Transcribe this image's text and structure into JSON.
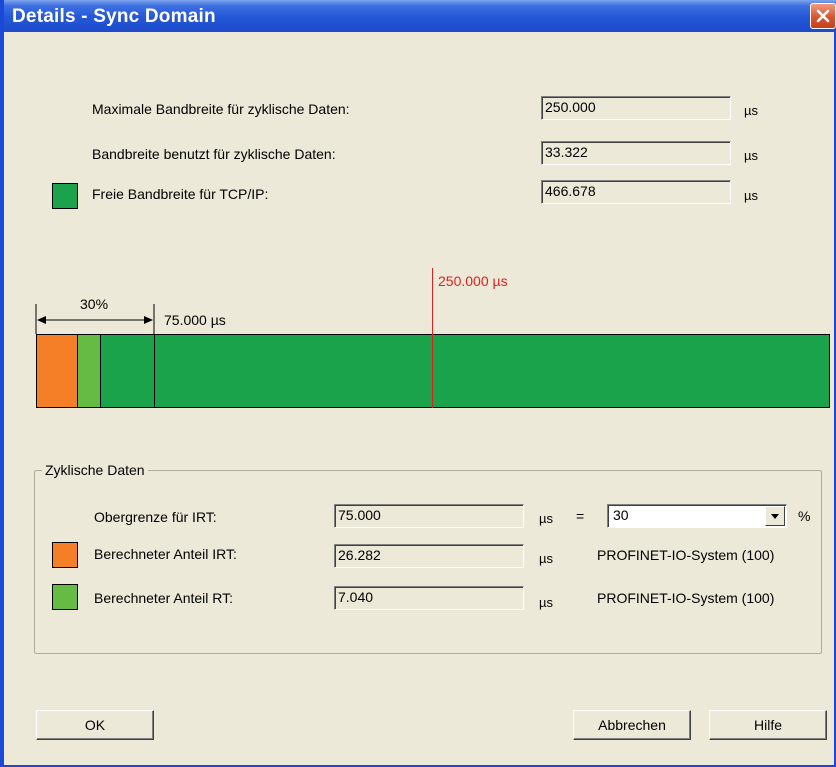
{
  "window": {
    "title": "Details - Sync Domain"
  },
  "bandwidth": {
    "max_label": "Maximale Bandbreite für zyklische Daten:",
    "max_value": "250.000",
    "used_label": "Bandbreite benutzt für zyklische Daten:",
    "used_value": "33.322",
    "free_label": "Freie Bandbreite für TCP/IP:",
    "free_value": "466.678",
    "unit": "µs",
    "free_color": "#1aa34a"
  },
  "chart": {
    "marker_label": "250.000 µs",
    "percent_label": "30%",
    "limit_label": "75.000 µs",
    "marker_color": "#e02020"
  },
  "cyclic": {
    "group_title": "Zyklische Daten",
    "irt_limit_label": "Obergrenze für IRT:",
    "irt_limit_value": "75.000",
    "unit": "µs",
    "equals": "=",
    "percent_value": "30",
    "percent_sign": "%",
    "irt_label": "Berechneter Anteil IRT:",
    "irt_value": "26.282",
    "irt_system": "PROFINET-IO-System (100)",
    "irt_color": "#f57f26",
    "rt_label": "Berechneter Anteil RT:",
    "rt_value": "7.040",
    "rt_system": "PROFINET-IO-System (100)",
    "rt_color": "#66bb44"
  },
  "buttons": {
    "ok": "OK",
    "cancel": "Abbrechen",
    "help": "Hilfe"
  }
}
